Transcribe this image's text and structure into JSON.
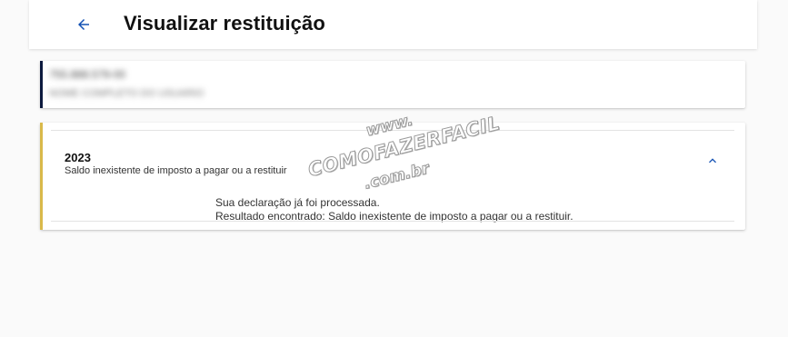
{
  "header": {
    "back_icon": "arrow-left-icon",
    "title": "Visualizar restituição"
  },
  "user_card": {
    "line1": "755.888.579-00",
    "line2": "NOME COMPLETO DO USUARIO"
  },
  "year_card": {
    "year": "2023",
    "subtitle": "Saldo inexistente de imposto a pagar ou a restituir",
    "collapse_icon": "chevron-up-icon",
    "detail_line1": "Sua declaração já foi processada.",
    "detail_line2": "Resultado encontrado: Saldo inexistente de imposto a pagar ou a restituir."
  },
  "watermark": {
    "line1": "www.",
    "line2": "COMOFAZERFACIL",
    "line3": ".com.br"
  },
  "colors": {
    "primary": "#1351b4",
    "user_accent": "#0c1a3e",
    "year_accent": "#d9b94a"
  }
}
